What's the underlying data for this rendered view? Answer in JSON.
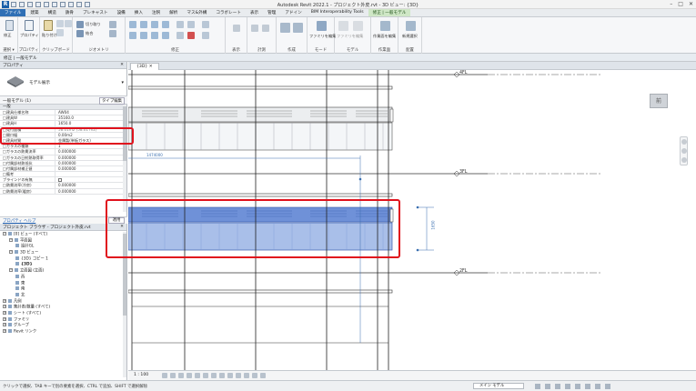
{
  "titlebar": {
    "app_logo": "R",
    "title": "Autodesk Revit 2022.1 - プロジェクト外皮.rvt - 3D ビュー: {3D}",
    "controls": [
      "–",
      "□",
      "✕"
    ]
  },
  "ribbon": {
    "tabs": [
      "ファイル",
      "建築",
      "構造",
      "鉄骨",
      "プレキャスト",
      "設備",
      "挿入",
      "注釈",
      "解析",
      "マス&外構",
      "コラボレート",
      "表示",
      "管理",
      "アドイン",
      "BIM Interoperability Tools",
      "修正 | 一般モデル"
    ],
    "panels": [
      {
        "label": "選択 ▾",
        "buttons": [
          "修正"
        ]
      },
      {
        "label": "プロパティ",
        "buttons": [
          "プロパティ"
        ]
      },
      {
        "label": "クリップボード",
        "buttons": [
          "貼り付け"
        ]
      },
      {
        "label": "ジオメトリ",
        "buttons": [
          "切り取り",
          "結合"
        ]
      },
      {
        "label": "修正",
        "buttons": []
      },
      {
        "label": "表示",
        "buttons": []
      },
      {
        "label": "計測",
        "buttons": []
      },
      {
        "label": "作成",
        "buttons": []
      },
      {
        "label": "モード",
        "buttons": [
          "ファミリを編集"
        ]
      },
      {
        "label": "モデル",
        "buttons": [
          "ファミリを編集"
        ]
      },
      {
        "label": "作業面",
        "buttons": [
          "作業面を編集"
        ]
      },
      {
        "label": "配置",
        "buttons": [
          "新規選択"
        ]
      }
    ]
  },
  "modebar": {
    "text": "修正 | 一般モデル"
  },
  "properties": {
    "title": "プロパティ",
    "type_name": "モデル展示",
    "instance_filter": "一般モデル (1)",
    "edit_type": "タイプ編集",
    "group": "一般",
    "rows": [
      {
        "name": "□建具仕様名称",
        "value": "AW04"
      },
      {
        "name": "□建具W",
        "value": "35160.0"
      },
      {
        "name": "□建具H",
        "value": "1650.0"
      },
      {
        "name": "□見付面積",
        "value": "58.01m2 (58.01 m2)",
        "dim": true
      },
      {
        "name": "□開口幅",
        "value": "0.00m2"
      },
      {
        "name": "□建具材質",
        "value": "金属製(単板ガラス)"
      },
      {
        "name": "□ガラスの種類",
        "value": "1"
      },
      {
        "name": "□ガラスの熱貫流率",
        "value": "0.000000"
      },
      {
        "name": "□ガラスの日射熱取得率",
        "value": "0.000000"
      },
      {
        "name": "□付属部材熱抵抗",
        "value": "0.000000"
      },
      {
        "name": "□付属部材補正値",
        "value": "0.000000"
      },
      {
        "name": "□備考",
        "value": ""
      },
      {
        "name": "ブラインドの有無",
        "value": "checkbox"
      },
      {
        "name": "□熱貫流率(冷房)",
        "value": "0.000000"
      },
      {
        "name": "□熱貫流率(暖房)",
        "value": "0.000000"
      }
    ],
    "help_link": "プロパティ ヘルプ",
    "apply_button": "適用"
  },
  "browser": {
    "title": "プロジェクト ブラウザ - プロジェクト外皮.rvt",
    "items": [
      {
        "label": "[0] ビュー (すべて)",
        "level": 0,
        "expanded": true
      },
      {
        "label": "平面図",
        "level": 1,
        "expanded": true
      },
      {
        "label": "設計GL",
        "level": 2
      },
      {
        "label": "3D ビュー",
        "level": 1,
        "expanded": true
      },
      {
        "label": "{3D} コピー 1",
        "level": 2
      },
      {
        "label": "{3D}",
        "level": 2,
        "bold": true
      },
      {
        "label": "立面図 (立面)",
        "level": 1,
        "expanded": true
      },
      {
        "label": "西",
        "level": 2
      },
      {
        "label": "東",
        "level": 2
      },
      {
        "label": "南",
        "level": 2
      },
      {
        "label": "北",
        "level": 2
      },
      {
        "label": "凡例",
        "level": 0,
        "expanded": false
      },
      {
        "label": "集計表/数量 (すべて)",
        "level": 0,
        "expanded": false
      },
      {
        "label": "シート (すべて)",
        "level": 0,
        "expanded": false
      },
      {
        "label": "ファミリ",
        "level": 0,
        "expanded": false
      },
      {
        "label": "グループ",
        "level": 0,
        "expanded": false
      },
      {
        "label": "Revit リンク",
        "level": 0,
        "expanded": false
      }
    ]
  },
  "view": {
    "tab_label": "{3D}",
    "viewcube_face": "前",
    "levels": [
      "4FL",
      "3FL",
      "2FL"
    ],
    "dimensions": [
      "1474000",
      "1650"
    ],
    "scale": "1 : 100"
  },
  "statusbar": {
    "message": "クリックで選択、TAB キーで別の要素を選択、CTRL で追加、SHIFT で選択解除",
    "model_selector": "メイン モデル"
  },
  "colors": {
    "highlight": "#e0121d",
    "selected_element": "#6a8fd8",
    "file_tab": "#2f6fb5",
    "context_tab": "#cfe7c6"
  }
}
